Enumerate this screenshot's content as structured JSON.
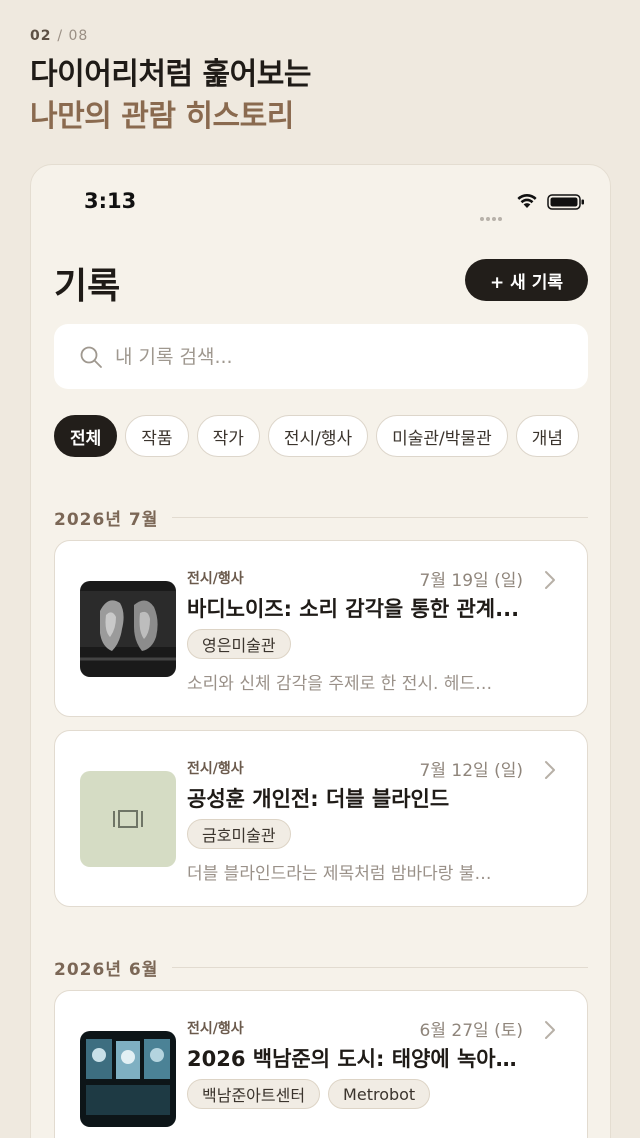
{
  "onboarding": {
    "page_current": "02",
    "page_total": "/ 08",
    "headline_line1": "다이어리처럼 훑어보는",
    "headline_line2": "나만의 관람 히스토리"
  },
  "status_bar": {
    "time": "3:13"
  },
  "header": {
    "title": "기록",
    "new_button_label": "+ 새 기록"
  },
  "search": {
    "placeholder": "내 기록 검색..."
  },
  "filters": [
    "전체",
    "작품",
    "작가",
    "전시/행사",
    "미술관/박물관",
    "개념"
  ],
  "sections": [
    {
      "label": "2026년 7월",
      "records": [
        {
          "category": "전시/행사",
          "date": "7월 19일 (일)",
          "title": "바디노이즈: 소리 감각을 통한 관계...",
          "tags": [
            "영은미술관"
          ],
          "description": "소리와 신체 감각을 주제로 한 전시. 헤드…"
        },
        {
          "category": "전시/행사",
          "date": "7월 12일 (일)",
          "title": "공성훈 개인전: 더블 블라인드",
          "tags": [
            "금호미술관"
          ],
          "description": "더블 블라인드라는 제목처럼 밤바다랑 불…"
        }
      ]
    },
    {
      "label": "2026년 6월",
      "records": [
        {
          "category": "전시/행사",
          "date": "6월 27일 (토)",
          "title": "2026 백남준의 도시: 태양에 녹아…",
          "tags": [
            "백남준아트센터",
            "Metrobot"
          ],
          "description": ""
        }
      ]
    }
  ],
  "colors": {
    "background": "#efe9df",
    "accent_brown": "#8a6a4f",
    "dark": "#221e1a",
    "placeholder_thumb": "#d5dcc4"
  }
}
